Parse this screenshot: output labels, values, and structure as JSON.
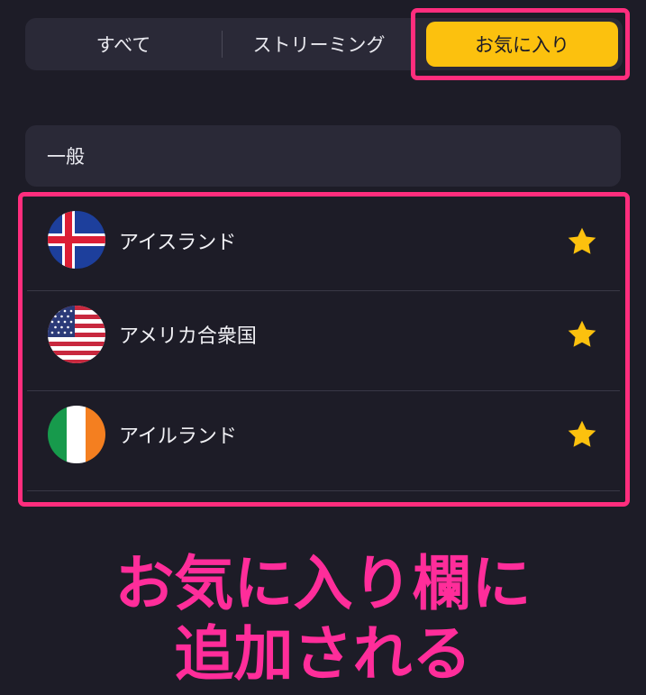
{
  "tabs": {
    "all": "すべて",
    "streaming": "ストリーミング",
    "favorites": "お気に入り",
    "active": "favorites"
  },
  "section": {
    "title": "一般"
  },
  "favorites": [
    {
      "country": "アイスランド",
      "flag": "iceland-flag-icon",
      "favorited": true
    },
    {
      "country": "アメリカ合衆国",
      "flag": "usa-flag-icon",
      "favorited": true
    },
    {
      "country": "アイルランド",
      "flag": "ireland-flag-icon",
      "favorited": true
    }
  ],
  "caption": {
    "line1": "お気に入り欄に",
    "line2": "追加される"
  },
  "colors": {
    "background": "#1d1c27",
    "panel": "#2a2937",
    "accent": "#fcc10e",
    "highlight": "#ff2d7d",
    "caption": "#ff2d9a"
  }
}
